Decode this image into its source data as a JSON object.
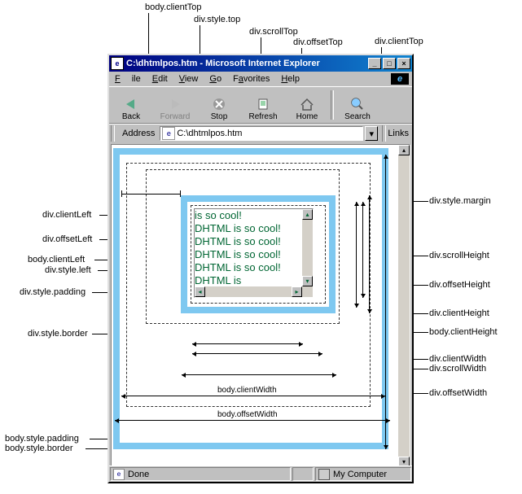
{
  "title": "C:\\dhtmlpos.htm - Microsoft Internet Explorer",
  "menu": {
    "file": "File",
    "edit": "Edit",
    "view": "View",
    "go": "Go",
    "fav": "Favorites",
    "help": "Help"
  },
  "tb": {
    "back": "Back",
    "fwd": "Forward",
    "stop": "Stop",
    "refresh": "Refresh",
    "home": "Home",
    "search": "Search"
  },
  "addr": {
    "label": "Address",
    "value": "C:\\dhtmlpos.htm",
    "links": "Links"
  },
  "status": {
    "done": "Done",
    "zone": "My Computer"
  },
  "content": "is so cool!\nDHTML is so cool! DHTML is so cool! DHTML is so cool!\nDHTML is so cool! DHTML is ",
  "lbl": {
    "bodyClientTop": "body.clientTop",
    "divStyleTop": "div.style.top",
    "divScrollTop": "div.scrollTop",
    "divOffsetTop": "div.offsetTop",
    "divClientTop": "div.clientTop",
    "divStyleMargin": "div.style.margin",
    "divScrollHeight": "div.scrollHeight",
    "divOffsetHeight": "div.offsetHeight",
    "divClientHeight": "div.clientHeight",
    "bodyClientHeight": "body.clientHeight",
    "divClientWidth": "div.clientWidth",
    "divScrollWidth": "div.scrollWidth",
    "divOffsetWidth": "div.offsetWidth",
    "divClientLeft": "div.clientLeft",
    "divOffsetLeft": "div.offsetLeft",
    "bodyClientLeft": "body.clientLeft",
    "divStyleLeft": "div.style.left",
    "divStylePadding": "div.style.padding",
    "divStyleBorder": "div.style.border",
    "bodyStylePadding": "body.style.padding",
    "bodyStyleBorder": "body.style.border",
    "bodyClientWidth": "body.clientWidth",
    "bodyOffsetWidth": "body.offsetWidth"
  }
}
